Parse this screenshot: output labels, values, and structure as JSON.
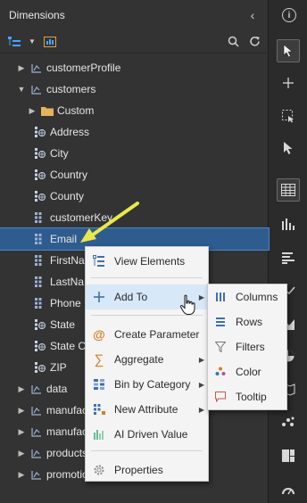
{
  "panel": {
    "title": "Dimensions",
    "collapse_icon": "chevron-left-icon"
  },
  "toolbar": {
    "icons": [
      "tree-view-icon",
      "dropdown-icon",
      "calendar-icon",
      "search-icon",
      "refresh-icon"
    ]
  },
  "tree": [
    {
      "label": "customerProfile",
      "depth": 0,
      "caret": "right",
      "icon": "dim-icon"
    },
    {
      "label": "customers",
      "depth": 0,
      "caret": "down",
      "icon": "dim-icon"
    },
    {
      "label": "Custom",
      "depth": 1,
      "caret": "right",
      "icon": "folder-icon"
    },
    {
      "label": "Address",
      "depth": 1,
      "caret": "",
      "icon": "geo-icon"
    },
    {
      "label": "City",
      "depth": 1,
      "caret": "",
      "icon": "geo-icon"
    },
    {
      "label": "Country",
      "depth": 1,
      "caret": "",
      "icon": "geo-icon"
    },
    {
      "label": "County",
      "depth": 1,
      "caret": "",
      "icon": "geo-icon"
    },
    {
      "label": "customerKey",
      "depth": 1,
      "caret": "",
      "icon": "dim-icon"
    },
    {
      "label": "Email",
      "depth": 1,
      "caret": "",
      "icon": "dim-icon",
      "selected": true
    },
    {
      "label": "FirstNa",
      "depth": 1,
      "caret": "",
      "icon": "dim-icon"
    },
    {
      "label": "LastNa",
      "depth": 1,
      "caret": "",
      "icon": "dim-icon"
    },
    {
      "label": "Phone",
      "depth": 1,
      "caret": "",
      "icon": "dim-icon"
    },
    {
      "label": "State",
      "depth": 1,
      "caret": "",
      "icon": "geo-icon"
    },
    {
      "label": "State C",
      "depth": 1,
      "caret": "",
      "icon": "geo-icon"
    },
    {
      "label": "ZIP",
      "depth": 1,
      "caret": "",
      "icon": "geo-icon"
    },
    {
      "label": "data",
      "depth": 0,
      "caret": "right",
      "icon": "dim-icon"
    },
    {
      "label": "manufac",
      "depth": 0,
      "caret": "right",
      "icon": "dim-icon"
    },
    {
      "label": "manufac",
      "depth": 0,
      "caret": "right",
      "icon": "dim-icon"
    },
    {
      "label": "products",
      "depth": 0,
      "caret": "right",
      "icon": "dim-icon"
    },
    {
      "label": "promotio",
      "depth": 0,
      "caret": "right",
      "icon": "dim-icon"
    }
  ],
  "context_menu": {
    "items": [
      {
        "label": "View Elements",
        "icon": "view-elements-icon"
      },
      {
        "label": "Add To",
        "icon": "plus-icon",
        "submenu": true,
        "highlighted": true
      },
      {
        "label": "Create Parameter",
        "icon": "at-icon"
      },
      {
        "label": "Aggregate",
        "icon": "sigma-icon",
        "submenu": true
      },
      {
        "label": "Bin by Category",
        "icon": "bin-icon",
        "submenu": true
      },
      {
        "label": "New Attribute",
        "icon": "new-attribute-icon",
        "submenu": true
      },
      {
        "label": "AI Driven Value",
        "icon": "ai-icon"
      },
      {
        "label": "Properties",
        "icon": "gear-icon"
      }
    ]
  },
  "submenu": {
    "items": [
      {
        "label": "Columns",
        "icon": "columns-icon"
      },
      {
        "label": "Rows",
        "icon": "rows-icon"
      },
      {
        "label": "Filters",
        "icon": "filter-icon"
      },
      {
        "label": "Color",
        "icon": "color-icon"
      },
      {
        "label": "Tooltip",
        "icon": "tooltip-icon"
      }
    ]
  },
  "colors": {
    "panel_bg": "#333333",
    "selection": "#2f5c8f",
    "menu_bg": "#f4f4f4",
    "menu_highlight": "#d7e8f8",
    "annotation_arrow": "#e8e84a"
  }
}
